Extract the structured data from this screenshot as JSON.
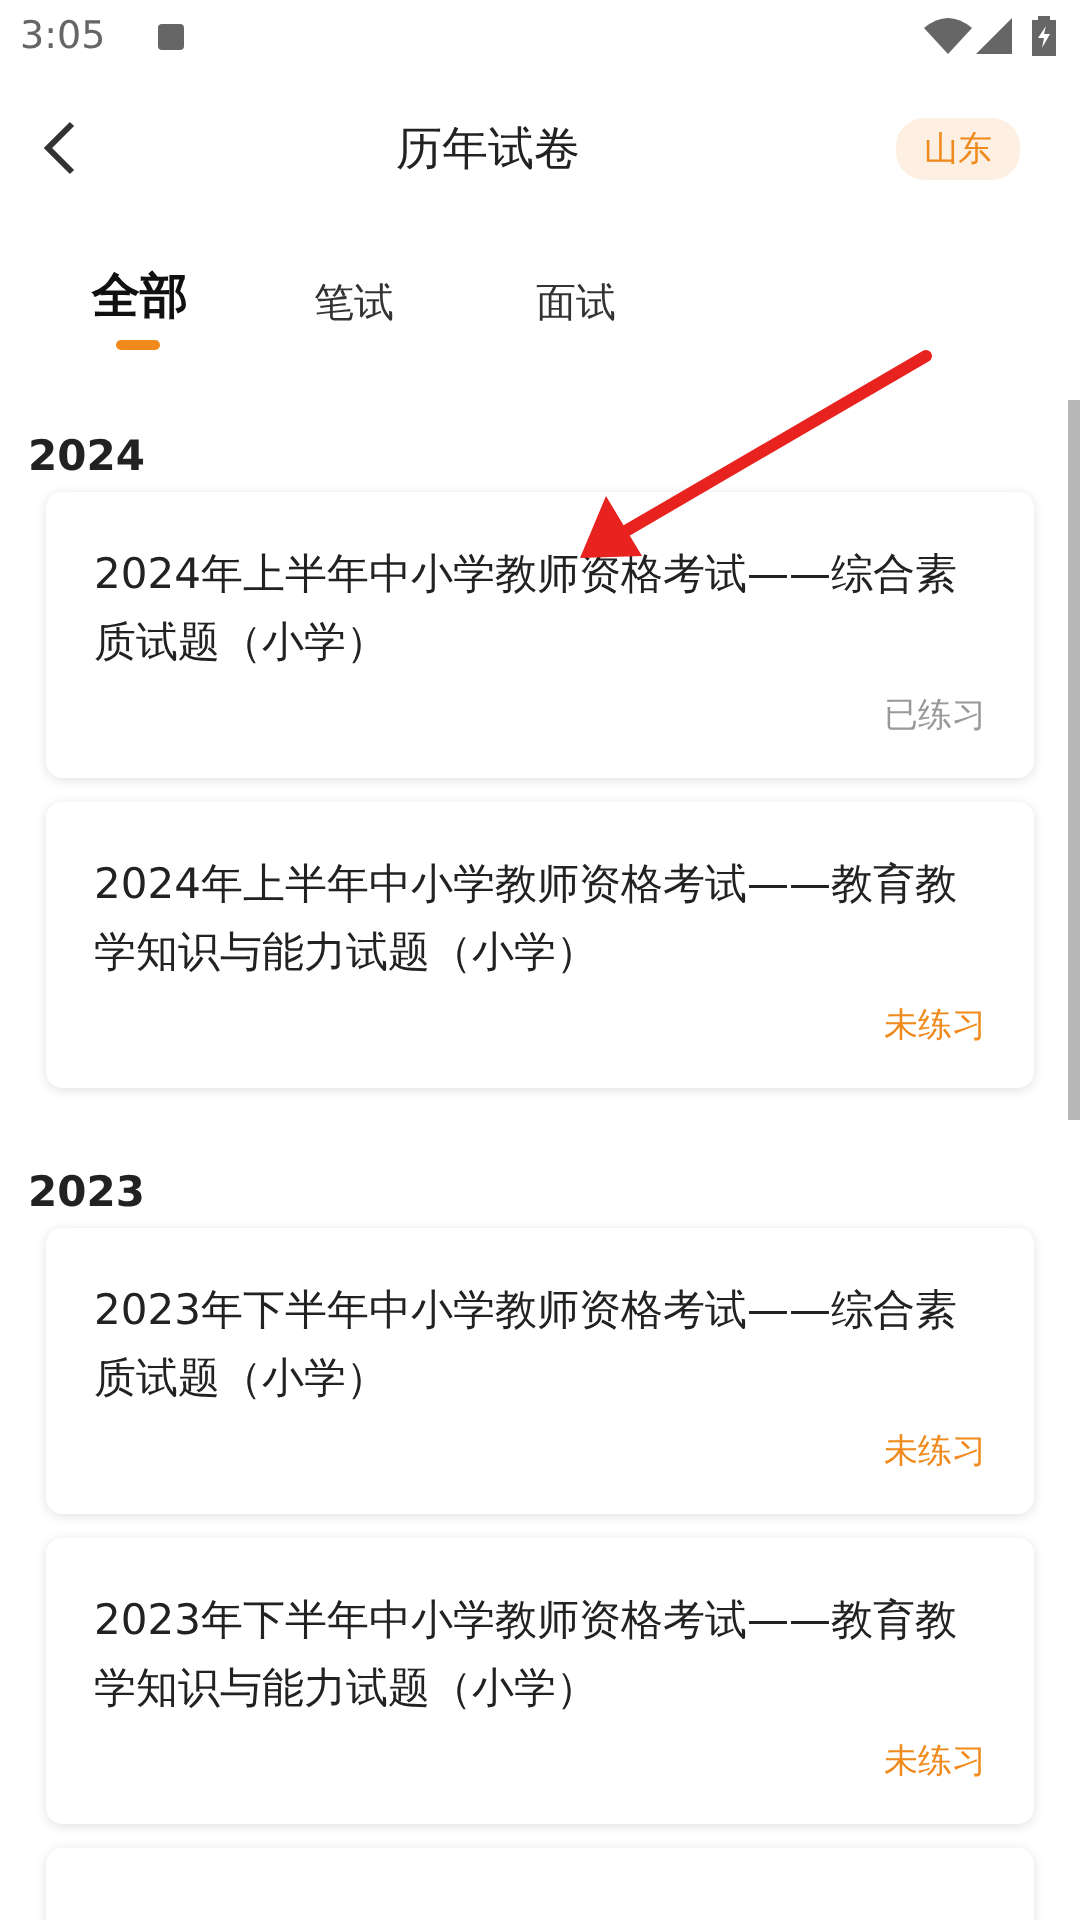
{
  "status_bar": {
    "time": "3:05"
  },
  "header": {
    "title": "历年试卷",
    "region": "山东"
  },
  "tabs": [
    {
      "label": "全部",
      "selected": true
    },
    {
      "label": "笔试",
      "selected": false
    },
    {
      "label": "面试",
      "selected": false
    }
  ],
  "sections": [
    {
      "year": "2024",
      "papers": [
        {
          "title": "2024年上半年中小学教师资格考试——综合素质试题（小学）",
          "status": "已练习",
          "practiced": true
        },
        {
          "title": "2024年上半年中小学教师资格考试——教育教学知识与能力试题（小学）",
          "status": "未练习",
          "practiced": false
        }
      ]
    },
    {
      "year": "2023",
      "papers": [
        {
          "title": "2023年下半年中小学教师资格考试——综合素质试题（小学）",
          "status": "未练习",
          "practiced": false
        },
        {
          "title": "2023年下半年中小学教师资格考试——教育教学知识与能力试题（小学）",
          "status": "未练习",
          "practiced": false
        }
      ]
    }
  ]
}
